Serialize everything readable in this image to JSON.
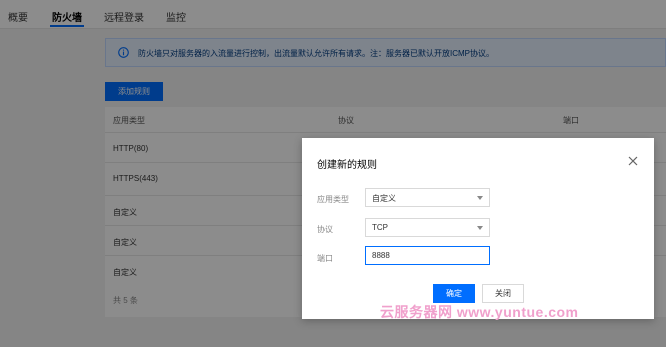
{
  "tabs": [
    "概要",
    "防火墙",
    "远程登录",
    "监控"
  ],
  "notice": "防火墙只对服务器的入流量进行控制，出流量默认允许所有请求。注：服务器已默认开放ICMP协议。",
  "add_rule_label": "添加规则",
  "table": {
    "headers": [
      "应用类型",
      "协议",
      "端口"
    ],
    "rows": [
      "HTTP(80)",
      "HTTPS(443)",
      "自定义",
      "自定义",
      "自定义"
    ],
    "footer": "共 5 条"
  },
  "dialog": {
    "title": "创建新的规则",
    "fields": {
      "app_type_label": "应用类型",
      "app_type_value": "自定义",
      "protocol_label": "协议",
      "protocol_value": "TCP",
      "port_label": "端口",
      "port_value": "8888"
    },
    "confirm_label": "确定",
    "close_label": "关闭"
  },
  "watermark": "云服务器网 www.yuntue.com",
  "colors": {
    "accent": "#006eff",
    "notice_bg": "#e5f0ff",
    "overlay": "rgba(0,0,0,0.45)"
  }
}
